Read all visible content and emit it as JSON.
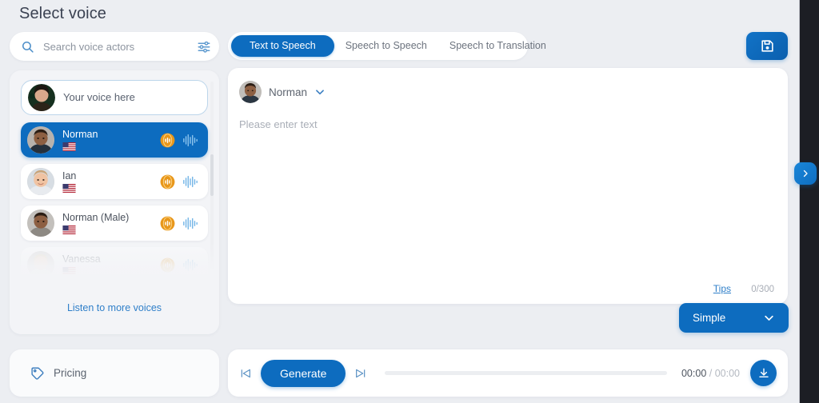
{
  "page": {
    "title": "Select voice"
  },
  "search": {
    "placeholder": "Search voice actors",
    "value": "",
    "icon": "search-icon",
    "filter_icon": "sliders-filter-icon"
  },
  "voice_list": {
    "your_voice_label": "Your voice here",
    "listen_more_label": "Listen to more voices",
    "items": [
      {
        "name": "Norman",
        "flag": "US",
        "selected": true,
        "state": "normal",
        "coin_icon": "coin-token-icon",
        "wave_icon": "waveform-icon"
      },
      {
        "name": "Ian",
        "flag": "US",
        "selected": false,
        "state": "normal",
        "coin_icon": "coin-token-icon",
        "wave_icon": "waveform-icon"
      },
      {
        "name": "Norman (Male)",
        "flag": "US",
        "selected": false,
        "state": "normal",
        "coin_icon": "coin-token-icon",
        "wave_icon": "waveform-icon"
      },
      {
        "name": "Vanessa",
        "flag": "US",
        "selected": false,
        "state": "faded",
        "coin_icon": "coin-token-icon",
        "wave_icon": "waveform-icon"
      }
    ]
  },
  "pricing": {
    "label": "Pricing",
    "icon": "price-tag-icon"
  },
  "tabs": [
    {
      "label": "Text to Speech",
      "active": true
    },
    {
      "label": "Speech to Speech",
      "active": false
    },
    {
      "label": "Speech to Translation",
      "active": false
    }
  ],
  "save_button": {
    "icon": "floppy-save-icon",
    "title": "Save"
  },
  "editor": {
    "voice_name": "Norman",
    "dropdown_icon": "chevron-down-icon",
    "placeholder": "Please enter text",
    "value": "",
    "tips_label": "Tips",
    "counter": "0/300"
  },
  "mode_button": {
    "label": "Simple",
    "icon": "chevron-down-icon"
  },
  "player": {
    "prev_icon": "skip-to-start-icon",
    "next_icon": "skip-to-end-icon",
    "generate_label": "Generate",
    "current_time": "00:00",
    "separator": "/",
    "total_time": "00:00",
    "progress_percent": 0,
    "download_icon": "download-icon"
  },
  "edge_tab": {
    "icon": "chevron-right-icon"
  },
  "colors": {
    "accent_blue": "#0d6cbf",
    "page_bg": "#eceef2",
    "card_bg": "#ffffff",
    "panel_bg": "#f3f4f7",
    "link_blue": "#2f7fc9",
    "coin_orange": "#e8971b",
    "dark_strip": "#1c1e24"
  }
}
